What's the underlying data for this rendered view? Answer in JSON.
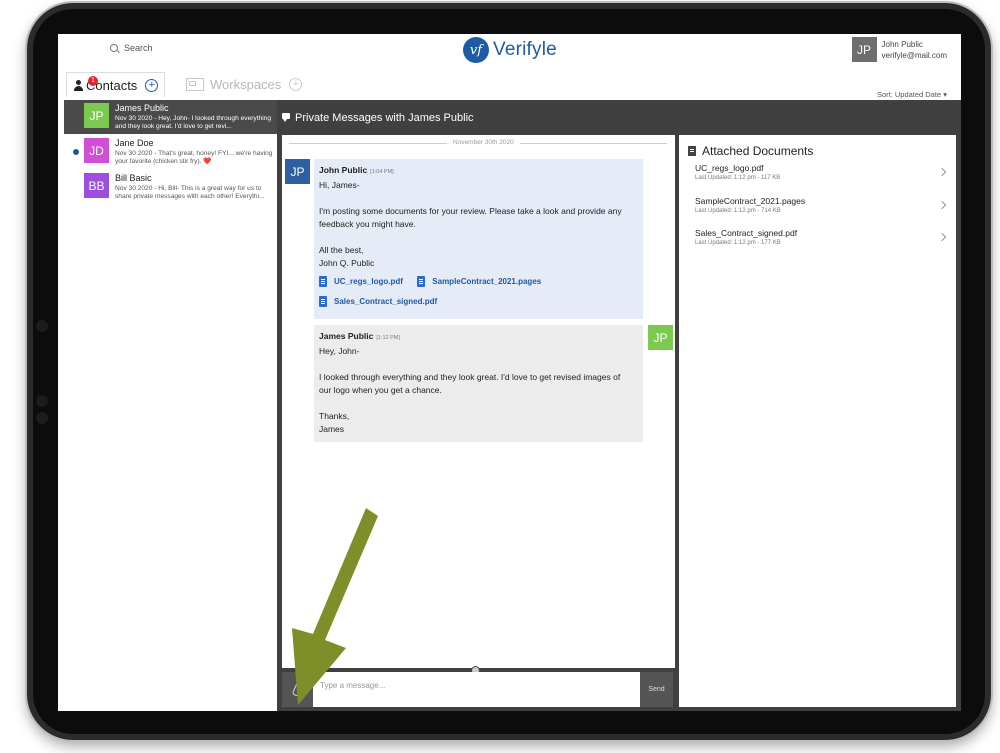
{
  "header": {
    "search_label": "Search",
    "logo_mark": "vf",
    "logo_text": "Verifyle",
    "user": {
      "initials": "JP",
      "name": "John Public",
      "email": "verifyle@mail.com"
    }
  },
  "tabs": {
    "contacts_label": "Contacts",
    "contacts_badge": "1",
    "workspaces_label": "Workspaces",
    "sort_label": "Sort: Updated Date ▾"
  },
  "contacts": [
    {
      "initials": "JP",
      "name": "James Public",
      "snippet": "Nov 30 2020 - Hey, John- I looked through everything and they look great. I'd love to get revi...",
      "color": "#7cc94f",
      "active": true,
      "unread": false
    },
    {
      "initials": "JD",
      "name": "Jane Doe",
      "snippet": "Nov 30 2020 - That's great, honey! FYI... we're having your favorite (chicken stir fry). ❤️",
      "color": "#d04fd6",
      "active": false,
      "unread": true
    },
    {
      "initials": "BB",
      "name": "Bill Basic",
      "snippet": "Nov 30 2020 - Hi, Bill- This is a great way for us to share private messages with each other! Everythi...",
      "color": "#9b4fdc",
      "active": false,
      "unread": false
    }
  ],
  "conversation": {
    "title": "Private Messages with James Public",
    "date_separator": "November 30th 2020",
    "messages": [
      {
        "initials": "JP",
        "avatar_color": "#2f5fa3",
        "author": "John Public",
        "time": "[1:04 PM]",
        "lines": [
          "Hi, James-",
          "",
          "I'm posting some documents for your review. Please take a look and provide any",
          "feedback you might have.",
          "",
          "All the best,",
          "John Q. Public"
        ],
        "files": [
          "UC_regs_logo.pdf",
          "SampleContract_2021.pages",
          "Sales_Contract_signed.pdf"
        ]
      },
      {
        "initials": "JP",
        "avatar_color": "#7cc94f",
        "author": "James Public",
        "time": "[1:12 PM]",
        "lines": [
          "Hey, John-",
          "",
          "I looked through everything and they look great. I'd love to get revised images of",
          "our logo when you get a chance.",
          "",
          "Thanks,",
          "James"
        ],
        "files": []
      }
    ],
    "composer_placeholder": "Type a message...",
    "send_label": "Send"
  },
  "documents": {
    "title": "Attached Documents",
    "items": [
      {
        "name": "UC_regs_logo.pdf",
        "meta": "Last Updated: 1:12 pm - 117 KB"
      },
      {
        "name": "SampleContract_2021.pages",
        "meta": "Last Updated: 1:12 pm - 714 KB"
      },
      {
        "name": "Sales_Contract_signed.pdf",
        "meta": "Last Updated: 1:12 pm - 177 KB"
      }
    ]
  },
  "colors": {
    "brand": "#1f5aa5",
    "arrow": "#7e8f2a"
  }
}
